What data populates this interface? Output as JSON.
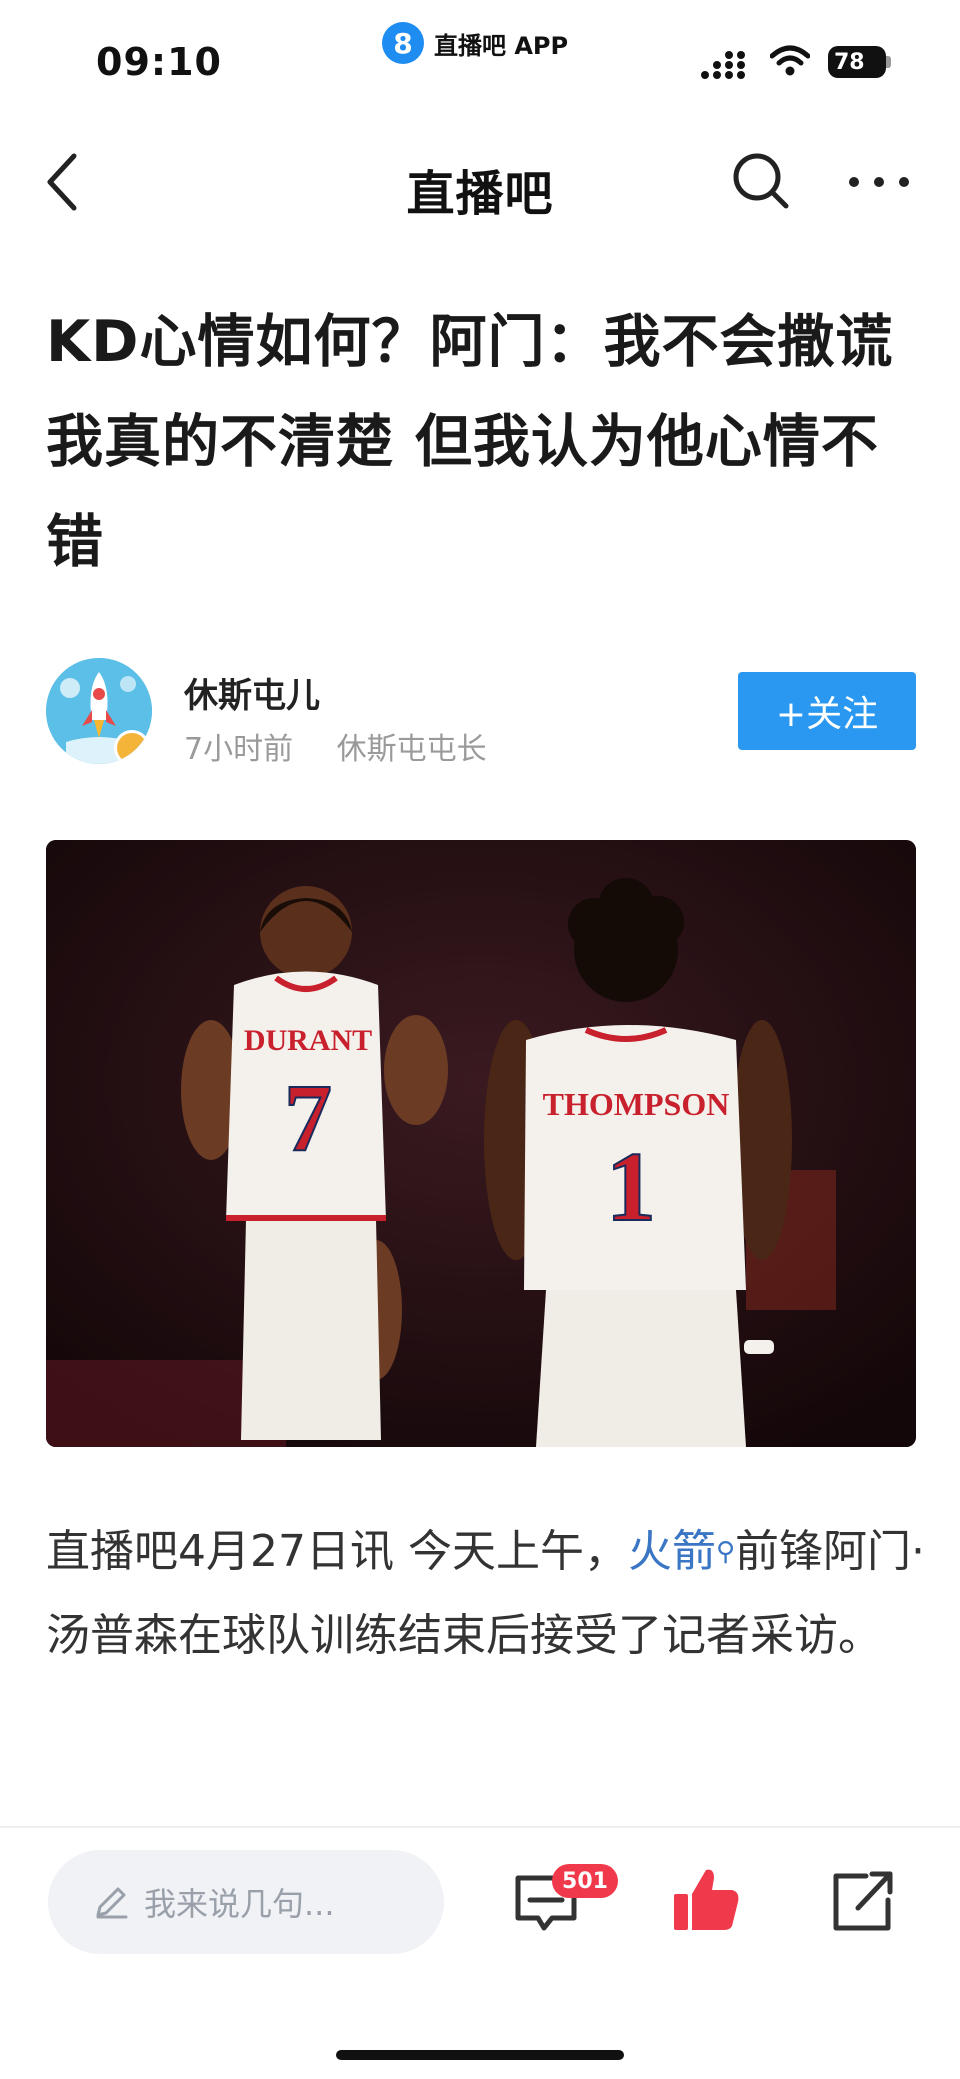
{
  "status_bar": {
    "time": "09:10",
    "app_icon_glyph": "8",
    "app_name": "直播吧 APP",
    "battery": "78"
  },
  "nav": {
    "title": "直播吧",
    "icons": [
      "back-icon",
      "search-icon",
      "more-icon"
    ]
  },
  "headline": "KD心情如何？阿门：我不会撒谎 我真的不清楚 但我认为他心情不错",
  "author": {
    "name": "休斯屯儿",
    "time_ago": "7小时前",
    "title": "休斯屯屯长",
    "follow_label": "+关注"
  },
  "photo": {
    "left_jersey_name": "DURANT",
    "left_jersey_number": "7",
    "right_jersey_name": "THOMPSON",
    "right_jersey_number": "1"
  },
  "article": {
    "prefix": "直播吧4月27日讯 今天上午，",
    "link": "火箭",
    "suffix": "前锋阿门·汤普森在球队训练结束后接受了记者采访。"
  },
  "bottom_bar": {
    "comment_placeholder": "我来说几句...",
    "comment_count": "501"
  },
  "colors": {
    "accent_blue": "#2a98f1",
    "link_blue": "#3a76c4",
    "like_red": "#f0394a",
    "badge_red": "#f0394a"
  }
}
